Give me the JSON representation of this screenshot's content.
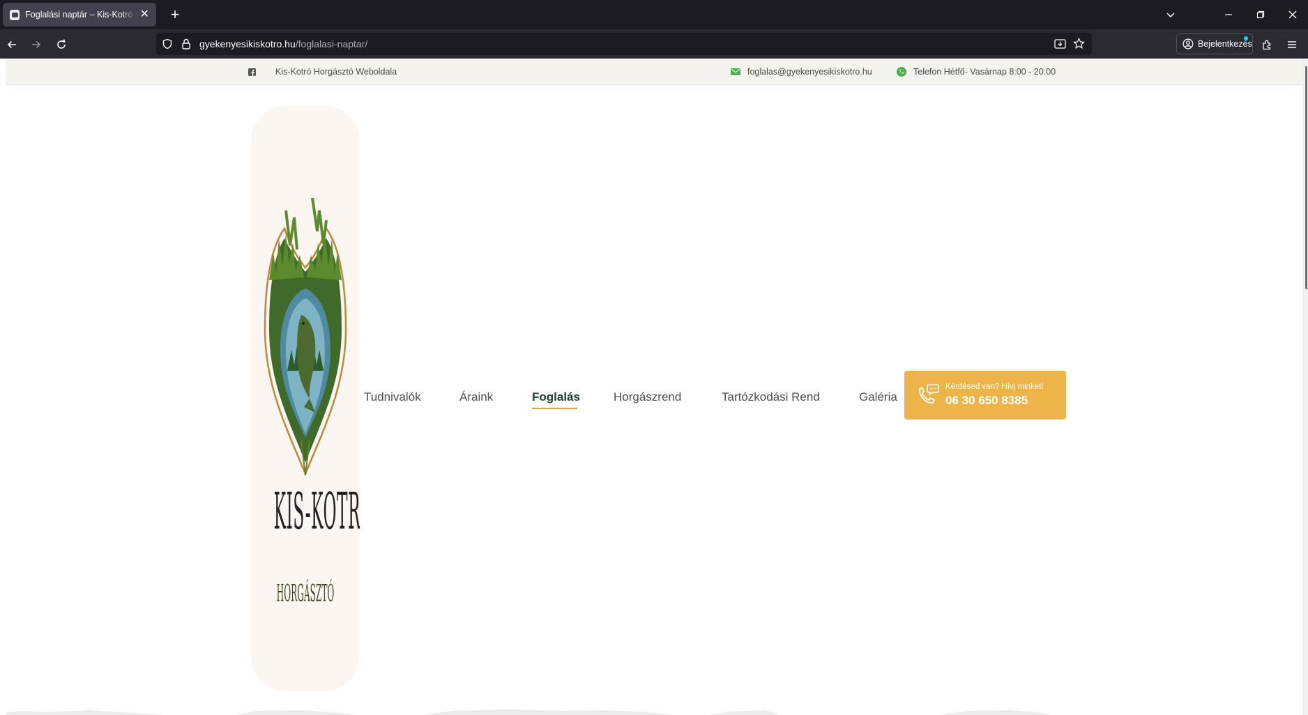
{
  "browser": {
    "tab_title": "Foglalási naptár – Kis-Kotró Horgásztó",
    "url_host": "gyekenyesikiskotro.hu",
    "url_path": "/foglalasi-naptar/",
    "signin_label": "Bejelentkezés"
  },
  "topbar": {
    "site_name": "Kis-Kotró Horgásztó Weboldala",
    "email": "foglalas@gyekenyesikiskotro.hu",
    "phone_hours": "Telefon Hétfő- Vasárnap 8:00 - 20:00"
  },
  "logo": {
    "title": "KIS-KOTRÓ",
    "subtitle": "HORGÁSZTÓ"
  },
  "menu": {
    "items": [
      "Tudnivalók",
      "Áraink",
      "Foglalás",
      "Horgászrend",
      "Tartózkodási Rend",
      "Galéria"
    ],
    "active_item": "Foglalás"
  },
  "cta": {
    "question": "Kérdésed van? Hívj minket!",
    "phone": "06 30 650 8385"
  },
  "colors": {
    "accent": "#ecb449",
    "active_menu": "#1f3f28",
    "topbar_bg": "#f4f3f0",
    "logo_panel": "#fcf6f3",
    "icon_green": "#4caf50"
  }
}
